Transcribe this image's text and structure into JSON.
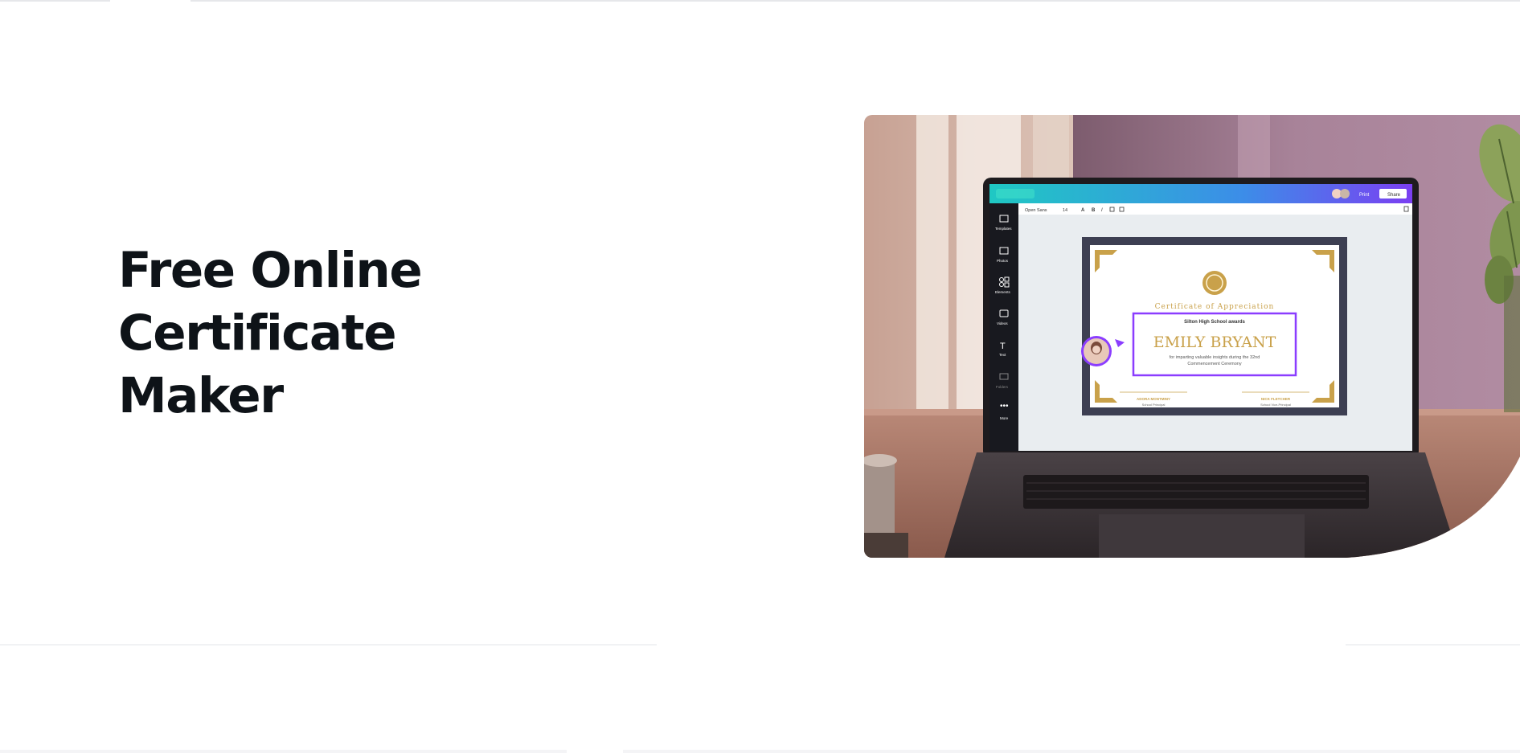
{
  "hero": {
    "title_line1": "Free Online Certificate",
    "title_line2": "Maker"
  },
  "mockup": {
    "editor": {
      "font_name": "Open Sans",
      "font_size": "14",
      "share_label": "Share",
      "print_label": "Print",
      "sidebar_items": [
        "Templates",
        "Photos",
        "Elements",
        "Videos",
        "Text",
        "Folders",
        "More"
      ]
    },
    "certificate": {
      "heading": "Certificate of Appreciation",
      "subheading": "Silton High School awards",
      "recipient": "EMILY BRYANT",
      "description_line1": "for imparting valuable insights during the 32nd",
      "description_line2": "Commencement Ceremony",
      "signer1_name": "ADORA MONTMINY",
      "signer1_title": "School Principal",
      "signer2_name": "NICK FLETCHER",
      "signer2_title": "School Vice-Principal"
    }
  },
  "colors": {
    "heading_text": "#0e1318",
    "editor_gradient_start": "#1fc8c3",
    "editor_gradient_end": "#7b3ff2",
    "certificate_gold": "#c9a14a",
    "selection_purple": "#8b3dff"
  }
}
